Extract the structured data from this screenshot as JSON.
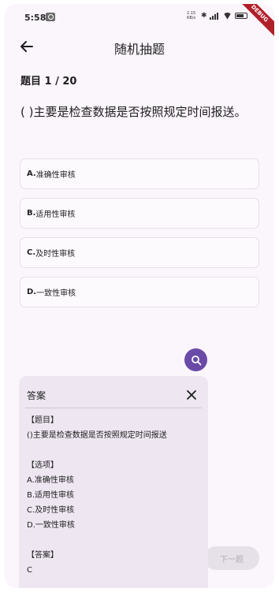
{
  "status_bar": {
    "time": "5:58",
    "speed_top": "2.15",
    "speed_bottom": "KB/s",
    "debug_label": "DEBUG"
  },
  "app_bar": {
    "title": "随机抽题",
    "back_icon": "arrow-left-icon"
  },
  "question": {
    "counter": "题目 1 / 20",
    "text": "(    )主要是检查数据是否按照规定时间报送。",
    "options": [
      {
        "letter": "A.",
        "text": "准确性审核"
      },
      {
        "letter": "B.",
        "text": "适用性审核"
      },
      {
        "letter": "C.",
        "text": "及时性审核"
      },
      {
        "letter": "D.",
        "text": "一致性审核"
      }
    ]
  },
  "fab": {
    "icon": "search-icon"
  },
  "answer_panel": {
    "title": "答案",
    "close_icon": "close-icon",
    "question_header": "【题目】",
    "question_text": "()主要是检查数据是否按照规定时间报送",
    "options_header": "【选项】",
    "options": [
      "A.准确性审核",
      "B.适用性审核",
      "C.及时性审核",
      "D.一致性审核"
    ],
    "answer_header": "【答案】",
    "answer": "C"
  },
  "next_button": {
    "label": "下一题"
  },
  "colors": {
    "background": "#fbf5fc",
    "accent": "#6a4aa8",
    "panel": "#eee7f2"
  }
}
